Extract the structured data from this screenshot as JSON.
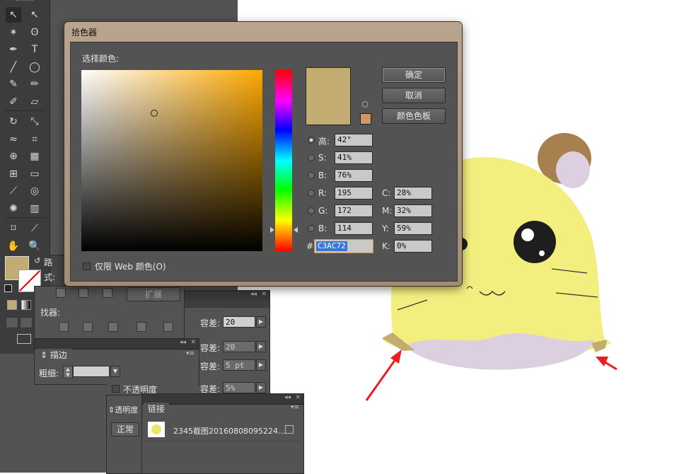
{
  "colors": {
    "selected": "#c3ac72",
    "gamut_warning": "#cc9966",
    "accent_red": "#ee1c1c"
  },
  "tools": [
    {
      "name": "selection-tool",
      "glyph": "↖"
    },
    {
      "name": "direct-selection-tool",
      "glyph": "↖"
    },
    {
      "name": "magic-wand-tool",
      "glyph": "✶"
    },
    {
      "name": "lasso-tool",
      "glyph": "ʘ"
    },
    {
      "name": "pen-tool",
      "glyph": "✒"
    },
    {
      "name": "type-tool",
      "glyph": "T"
    },
    {
      "name": "line-tool",
      "glyph": "╱"
    },
    {
      "name": "ellipse-tool",
      "glyph": "◯"
    },
    {
      "name": "paintbrush-tool",
      "glyph": "✎"
    },
    {
      "name": "pencil-tool",
      "glyph": "✏"
    },
    {
      "name": "blob-brush-tool",
      "glyph": "✐"
    },
    {
      "name": "eraser-tool",
      "glyph": "▱"
    },
    {
      "name": "rotate-tool",
      "glyph": "↻"
    },
    {
      "name": "scale-tool",
      "glyph": "⤡"
    },
    {
      "name": "width-tool",
      "glyph": "≈"
    },
    {
      "name": "free-transform-tool",
      "glyph": "⌗"
    },
    {
      "name": "shape-builder-tool",
      "glyph": "⊕"
    },
    {
      "name": "perspective-tool",
      "glyph": "▦"
    },
    {
      "name": "mesh-tool",
      "glyph": "⊞"
    },
    {
      "name": "gradient-tool",
      "glyph": "▭"
    },
    {
      "name": "eyedropper-tool",
      "glyph": "⟋"
    },
    {
      "name": "blend-tool",
      "glyph": "◎"
    },
    {
      "name": "symbol-sprayer-tool",
      "glyph": "✺"
    },
    {
      "name": "column-graph-tool",
      "glyph": "▥"
    },
    {
      "name": "artboard-tool",
      "glyph": "⌑"
    },
    {
      "name": "slice-tool",
      "glyph": "⟋"
    },
    {
      "name": "hand-tool",
      "glyph": "✋"
    },
    {
      "name": "zoom-tool",
      "glyph": "🔍"
    }
  ],
  "dialog": {
    "title": "拾色器",
    "select_color_label": "选择颜色:",
    "ok": "确定",
    "cancel": "取消",
    "swatches": "颜色色板",
    "web_only_label": "仅限 Web 颜色(O)",
    "hsb": [
      {
        "label": "高:",
        "value": "42°",
        "selected": true
      },
      {
        "label": "S:",
        "value": "41%",
        "selected": false
      },
      {
        "label": "B:",
        "value": "76%",
        "selected": false
      }
    ],
    "rgb": [
      {
        "label": "R:",
        "value": "195"
      },
      {
        "label": "G:",
        "value": "172"
      },
      {
        "label": "B:",
        "value": "114"
      }
    ],
    "cmyk": [
      {
        "label": "C:",
        "value": "28%"
      },
      {
        "label": "M:",
        "value": "32%"
      },
      {
        "label": "Y:",
        "value": "59%"
      },
      {
        "label": "K:",
        "value": "0%"
      }
    ],
    "hex_label": "#",
    "hex_value": "C3AC72"
  },
  "panels": {
    "path_partial": "路",
    "style_partial": "式:",
    "finder_partial": "找器:",
    "expand": "扩展",
    "tolerance_label": "容差:",
    "tolerance_value": "20",
    "tolerance2_value": "20",
    "tolerance3_value": "5 pt",
    "tolerance4_value": "5%",
    "stroke_tab": "描边",
    "weight_label": "粗细:",
    "opacity_label": "不透明度",
    "transparency_tab": "透明度",
    "blend_mode": "正常",
    "links_tab": "链接",
    "link_file": "2345截图20160808095224..."
  }
}
